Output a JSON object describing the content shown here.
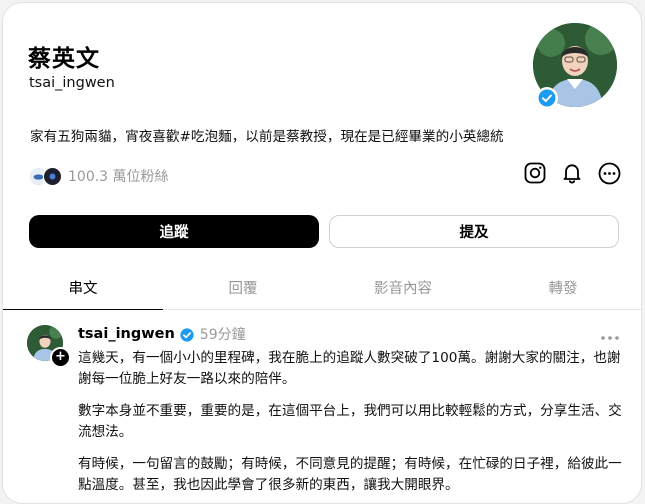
{
  "profile": {
    "display_name": "蔡英文",
    "handle": "tsai_ingwen",
    "bio": "家有五狗兩貓，宵夜喜歡#吃泡麵，以前是蔡教授，現在是已經畢業的小英總統",
    "followers": "100.3 萬位粉絲"
  },
  "actions": {
    "follow_label": "追蹤",
    "mention_label": "提及"
  },
  "tabs": [
    {
      "label": "串文",
      "active": true
    },
    {
      "label": "回覆",
      "active": false
    },
    {
      "label": "影音內容",
      "active": false
    },
    {
      "label": "轉發",
      "active": false
    }
  ],
  "post": {
    "author": "tsai_ingwen",
    "time": "59分鐘",
    "paragraphs": [
      "這幾天，有一個小小的里程碑，我在脆上的追蹤人數突破了100萬。謝謝大家的關注，也謝謝每一位脆上好友一路以來的陪伴。",
      "數字本身並不重要，重要的是，在這個平台上，我們可以用比較輕鬆的方式，分享生活、交流想法。",
      "有時候，一句留言的鼓勵；有時候，不同意見的提醒；有時候，在忙碌的日子裡，給彼此一點溫度。甚至，我也因此學會了很多新的東西，讓我大開眼界。"
    ]
  },
  "icons": {
    "verified": "verified-badge-icon",
    "instagram": "instagram-icon",
    "notification": "bell-icon",
    "more": "more-icon"
  },
  "colors": {
    "verified_blue": "#1d9bf0",
    "follow_bg": "#000000",
    "muted_text": "#999999"
  }
}
